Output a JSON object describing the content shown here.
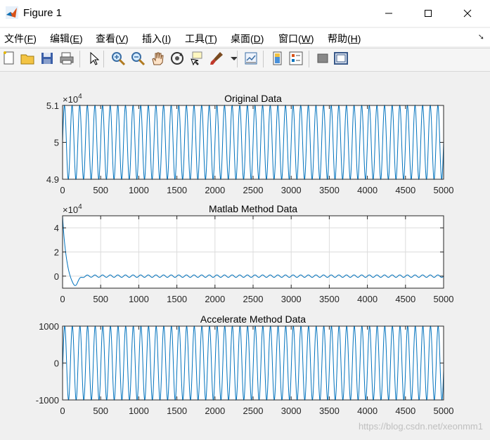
{
  "window": {
    "title": "Figure 1"
  },
  "menu": [
    {
      "label": "文件(",
      "key": "F",
      "tail": ")"
    },
    {
      "label": "编辑(",
      "key": "E",
      "tail": ")"
    },
    {
      "label": "查看(",
      "key": "V",
      "tail": ")"
    },
    {
      "label": "插入(",
      "key": "I",
      "tail": ")"
    },
    {
      "label": "工具(",
      "key": "T",
      "tail": ")"
    },
    {
      "label": "桌面(",
      "key": "D",
      "tail": ")"
    },
    {
      "label": "窗口(",
      "key": "W",
      "tail": ")"
    },
    {
      "label": "帮助(",
      "key": "H",
      "tail": ")"
    }
  ],
  "toolbar_icons": [
    "new-figure-icon",
    "open-file-icon",
    "save-icon",
    "print-icon",
    "pointer-icon",
    "zoom-in-icon",
    "zoom-out-icon",
    "pan-icon",
    "rotate-3d-icon",
    "data-cursor-icon",
    "brush-icon",
    "brush-dropdown-icon",
    "link-plot-icon",
    "colorbar-icon",
    "legend-icon",
    "hide-plot-tools-icon",
    "show-plot-tools-icon"
  ],
  "watermark": "https://blog.csdn.net/xeonmm1",
  "colors": {
    "line": "#0072bd",
    "axes_bg": "#ffffff",
    "figure_bg": "#f0f0f0",
    "grid": "#dcdcdc"
  },
  "chart_data": [
    {
      "type": "line",
      "title": "Original Data",
      "exponent_label": "×10",
      "exponent": "4",
      "xlim": [
        0,
        5000
      ],
      "ylim": [
        49000,
        51000
      ],
      "xticks": [
        0,
        500,
        1000,
        1500,
        2000,
        2500,
        3000,
        3500,
        4000,
        4500,
        5000
      ],
      "yticks": [
        49000,
        50000,
        51000
      ],
      "ytick_labels": [
        "4.9",
        "5",
        "5.1"
      ],
      "grid": false,
      "series": [
        {
          "offset": 50000,
          "amplitude": 1000,
          "cycles": 50,
          "decay": 0
        }
      ]
    },
    {
      "type": "line",
      "title": "Matlab Method Data",
      "exponent_label": "×10",
      "exponent": "4",
      "xlim": [
        0,
        5000
      ],
      "ylim": [
        -10000,
        50000
      ],
      "xticks": [
        0,
        500,
        1000,
        1500,
        2000,
        2500,
        3000,
        3500,
        4000,
        4500,
        5000
      ],
      "yticks": [
        0,
        20000,
        40000
      ],
      "ytick_labels": [
        "0",
        "2",
        "4"
      ],
      "grid": true,
      "series": [
        {
          "start": 50000,
          "dip": -9000,
          "ripple": 1000,
          "cycles": 50
        }
      ]
    },
    {
      "type": "line",
      "title": "Accelerate Method Data",
      "exponent_label": "",
      "exponent": "",
      "xlim": [
        0,
        5000
      ],
      "ylim": [
        -1000,
        1000
      ],
      "xticks": [
        0,
        500,
        1000,
        1500,
        2000,
        2500,
        3000,
        3500,
        4000,
        4500,
        5000
      ],
      "yticks": [
        -1000,
        0,
        1000
      ],
      "ytick_labels": [
        "-1000",
        "0",
        "1000"
      ],
      "grid": false,
      "series": [
        {
          "offset": 0,
          "amplitude": 1000,
          "cycles": 50,
          "decay": 0
        }
      ]
    }
  ]
}
